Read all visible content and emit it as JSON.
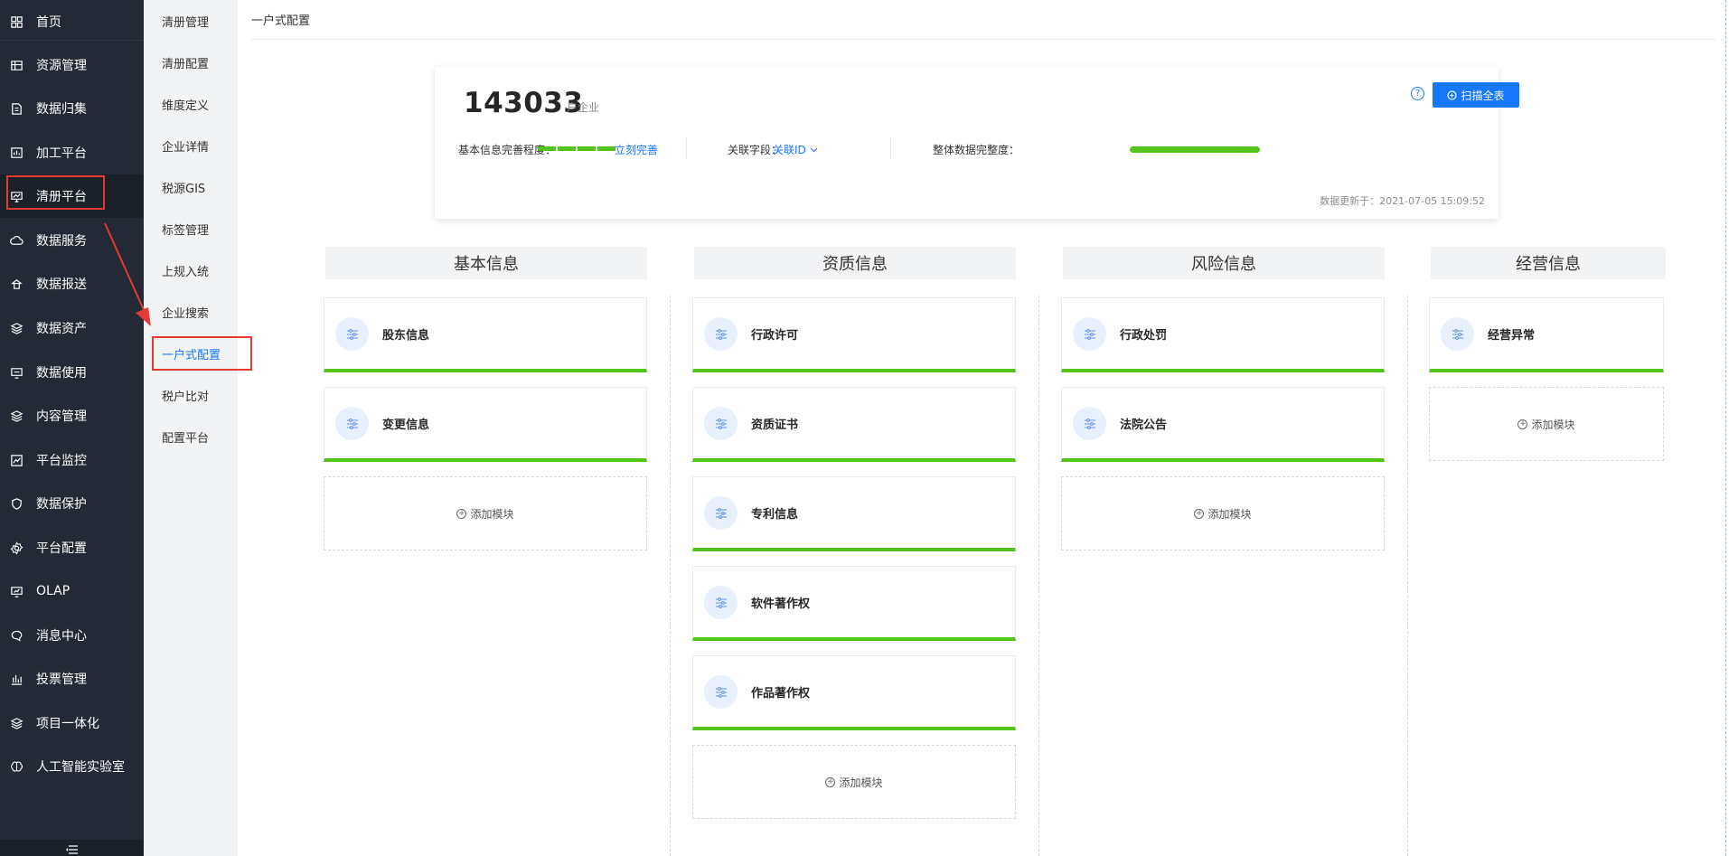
{
  "nav": {
    "items": [
      {
        "label": "首页",
        "icon": "grid-icon"
      },
      {
        "label": "资源管理",
        "icon": "table-icon"
      },
      {
        "label": "数据归集",
        "icon": "collect-icon"
      },
      {
        "label": "加工平台",
        "icon": "process-icon"
      },
      {
        "label": "清册平台",
        "icon": "monitor-icon"
      },
      {
        "label": "数据服务",
        "icon": "cloud-icon"
      },
      {
        "label": "数据报送",
        "icon": "upload-icon"
      },
      {
        "label": "数据资产",
        "icon": "layers-icon"
      },
      {
        "label": "数据使用",
        "icon": "screen-icon"
      },
      {
        "label": "内容管理",
        "icon": "layers-icon"
      },
      {
        "label": "平台监控",
        "icon": "chart-icon"
      },
      {
        "label": "数据保护",
        "icon": "shield-icon"
      },
      {
        "label": "平台配置",
        "icon": "gear-icon"
      },
      {
        "label": "OLAP",
        "icon": "olap-icon"
      },
      {
        "label": "消息中心",
        "icon": "message-icon"
      },
      {
        "label": "投票管理",
        "icon": "bar-chart-icon"
      },
      {
        "label": "项目一体化",
        "icon": "layers-icon"
      },
      {
        "label": "人工智能实验室",
        "icon": "brain-icon"
      }
    ]
  },
  "subnav": {
    "items": [
      "清册管理",
      "清册配置",
      "维度定义",
      "企业详情",
      "税源GIS",
      "标签管理",
      "上规入统",
      "企业搜索",
      "一户式配置",
      "税户比对",
      "配置平台"
    ]
  },
  "page": {
    "title": "一户式配置"
  },
  "summary": {
    "total": "143033",
    "total_unit": "户企业",
    "help": "?",
    "scan_label": "扫描全表",
    "basic_label": "基本信息完善程度：",
    "basic_link": "立刻完善",
    "basic_segments_filled": 4,
    "field_label": "关联字段：",
    "field_value": "关联ID",
    "overall_label": "整体数据完整度：",
    "overall_ratio": 1.0,
    "updated": "数据更新于：2021-07-05 15:09:52"
  },
  "columns": [
    {
      "title": "基本信息",
      "modules": [
        "股东信息",
        "变更信息"
      ],
      "add_label": "添加模块"
    },
    {
      "title": "资质信息",
      "modules": [
        "行政许可",
        "资质证书",
        "专利信息",
        "软件著作权",
        "作品著作权"
      ],
      "add_label": "添加模块"
    },
    {
      "title": "风险信息",
      "modules": [
        "行政处罚",
        "法院公告"
      ],
      "add_label": "添加模块"
    },
    {
      "title": "经营信息",
      "modules": [
        "经营异常"
      ],
      "add_label": "添加模块"
    }
  ],
  "colors": {
    "nav_bg": "#232a35",
    "accent": "#1677ff",
    "progress": "#52c41a",
    "annotation": "#e53935"
  }
}
